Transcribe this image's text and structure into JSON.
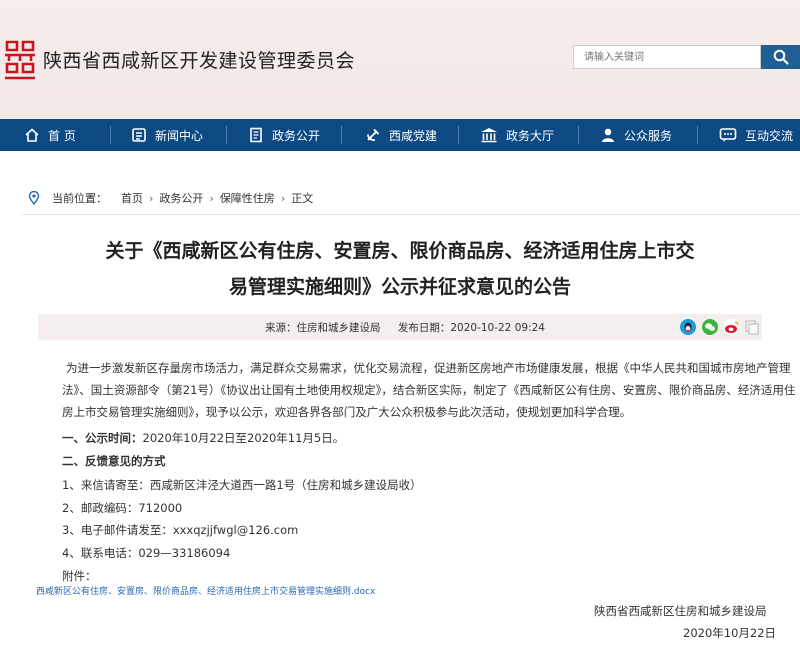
{
  "header": {
    "site_title": "陕西省西咸新区开发建设管理委员会",
    "search_placeholder": "请输入关键词",
    "logo_icon": "red-seal-logo-icon",
    "brand_red": "#c8161d"
  },
  "nav": {
    "items": [
      {
        "label": "首 页",
        "icon": "home-icon"
      },
      {
        "label": "新闻中心",
        "icon": "news-icon"
      },
      {
        "label": "政务公开",
        "icon": "document-icon"
      },
      {
        "label": "西咸党建",
        "icon": "party-emblem-icon"
      },
      {
        "label": "政务大厅",
        "icon": "hall-icon"
      },
      {
        "label": "公众服务",
        "icon": "user-icon"
      },
      {
        "label": "互动交流",
        "icon": "chat-icon"
      }
    ],
    "background": "#0d4a84"
  },
  "breadcrumb": {
    "prefix": "当前位置：",
    "items": [
      "首页",
      "政务公开",
      "保障性住房",
      "正文"
    ]
  },
  "article": {
    "title_line1": "关于《西咸新区公有住房、安置房、限价商品房、经济适用住房上市交",
    "title_line2": "易管理实施细则》公示并征求意见的公告",
    "source_label": "来源：",
    "source": "住房和城乡建设局",
    "date_label": "发布日期：",
    "date": "2020-10-22 09:24",
    "intro_line1": "为进一步激发新区存量房市场活力，满足群众交易需求，优化交易流程，促进新区房地产市场健康发展，根据《中华人民共和国城市房地产管理",
    "intro_line2": "法》、国土资源部令（第21号）《协议出让国有土地使用权规定》，结合新区实际，制定了《西咸新区公有住房、安置房、限价商品房、经济适用住",
    "intro_line3": "房上市交易管理实施细则》，现予以公示，欢迎各界各部门及广大公众积极参与此次活动，使规划更加科学合理。",
    "s1_heading": "一、公示时间：",
    "s1_text": "2020年10月22日至2020年11月5日。",
    "s2_heading": "二、反馈意见的方式",
    "items": [
      "1、来信请寄至：西咸新区沣泾大道西一路1号（住房和城乡建设局收）",
      "2、邮政编码：712000",
      "3、电子邮件请发至：xxxqzjjfwgl@126.com",
      "4、联系电话：029—33186094"
    ],
    "attachment_label": "附件：",
    "attachment_link": "西咸新区公有住房、安置房、限价商品房、经济适用住房上市交易管理实施细则.docx",
    "sign_org": "陕西省西咸新区住房和城乡建设局",
    "sign_date": "2020年10月22日"
  },
  "share": {
    "icons": [
      "qq-icon",
      "wechat-icon",
      "weibo-icon",
      "copy-icon"
    ]
  }
}
